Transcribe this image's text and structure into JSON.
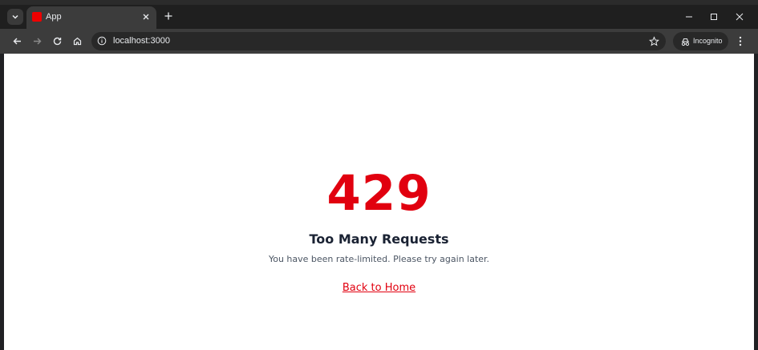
{
  "browser": {
    "tab_title": "App",
    "url": "localhost:3000",
    "profile_label": "Incognito",
    "favicon_color": "#ee0000"
  },
  "icons": {
    "tab_search": "chevron-down-icon",
    "tab_close": "close-icon",
    "new_tab": "plus-icon",
    "minimize": "minimize-icon",
    "maximize": "maximize-icon",
    "close": "close-icon",
    "back": "arrow-left-icon",
    "forward": "arrow-right-icon",
    "reload": "reload-icon",
    "home": "home-icon",
    "site_info": "info-icon",
    "bookmark": "star-icon",
    "incognito": "incognito-icon",
    "menu": "kebab-menu-icon"
  },
  "page": {
    "error_code": "429",
    "title": "Too Many Requests",
    "message": "You have been rate-limited. Please try again later.",
    "home_link": "Back to Home",
    "accent_color": "#e1000f"
  }
}
